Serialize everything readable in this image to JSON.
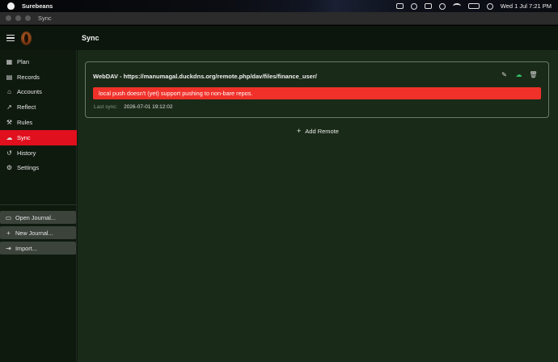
{
  "menubar": {
    "app_name": "Surebeans",
    "clock": "Wed 1 Jul  7:21 PM"
  },
  "window": {
    "title": "Sync"
  },
  "header": {
    "page_title": "Sync"
  },
  "sidebar": {
    "items": [
      {
        "label": "Plan",
        "icon": "calendar-icon",
        "active": false
      },
      {
        "label": "Records",
        "icon": "document-icon",
        "active": false
      },
      {
        "label": "Accounts",
        "icon": "bank-icon",
        "active": false
      },
      {
        "label": "Reflect",
        "icon": "chart-line-icon",
        "active": false
      },
      {
        "label": "Rules",
        "icon": "gavel-icon",
        "active": false
      },
      {
        "label": "Sync",
        "icon": "cloud-icon",
        "active": true
      },
      {
        "label": "History",
        "icon": "history-icon",
        "active": false
      },
      {
        "label": "Settings",
        "icon": "gear-icon",
        "active": false
      }
    ],
    "actions": [
      {
        "label": "Open Journal...",
        "icon": "folder-icon"
      },
      {
        "label": "New Journal...",
        "icon": "plus-icon"
      },
      {
        "label": "Import...",
        "icon": "import-icon"
      }
    ]
  },
  "remote": {
    "title": "WebDAV - https://manumagal.duckdns.org/remote.php/dav/files/finance_user/",
    "error": "local push doesn't (yet) support pushing to non-bare repos.",
    "last_sync_label": "Last sync:",
    "last_sync_value": "2026-07-01 19:12:02"
  },
  "add_remote_label": "Add Remote",
  "colors": {
    "active_nav": "#e0101e",
    "error_banner": "#f0312a",
    "sync_cloud": "#32c26a",
    "main_bg": "#1a2a18"
  }
}
